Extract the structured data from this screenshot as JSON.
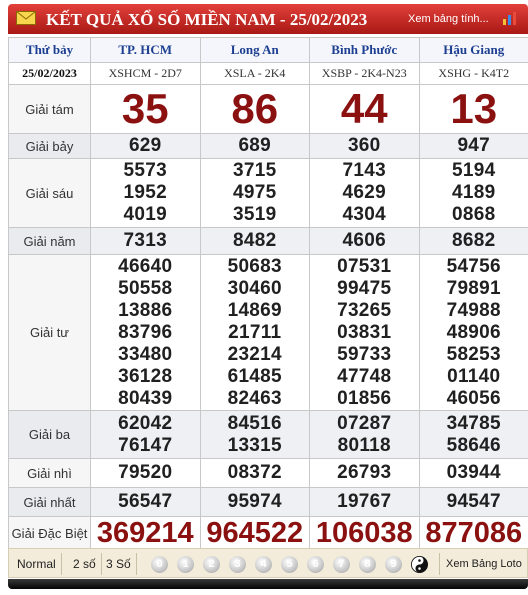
{
  "header": {
    "title": "KẾT QUẢ XỔ SỐ MIỀN NAM - 25/02/2023",
    "link": "Xem bảng tính...",
    "mail_icon": "envelope-icon",
    "chart_icon": "bar-chart-icon"
  },
  "day": "Thứ bảy",
  "date": "25/02/2023",
  "provinces": [
    {
      "name": "TP. HCM",
      "code": "XSHCM - 2D7"
    },
    {
      "name": "Long An",
      "code": "XSLA - 2K4"
    },
    {
      "name": "Bình Phước",
      "code": "XSBP - 2K4-N23"
    },
    {
      "name": "Hậu Giang",
      "code": "XSHG - K4T2"
    }
  ],
  "prizes": {
    "g8": {
      "label": "Giải tám",
      "values": [
        "35",
        "86",
        "44",
        "13"
      ]
    },
    "g7": {
      "label": "Giải bảy",
      "values": [
        "629",
        "689",
        "360",
        "947"
      ]
    },
    "g6": {
      "label": "Giải sáu",
      "values": [
        [
          "5573",
          "1952",
          "4019"
        ],
        [
          "3715",
          "4975",
          "3519"
        ],
        [
          "7143",
          "4629",
          "4304"
        ],
        [
          "5194",
          "4189",
          "0868"
        ]
      ]
    },
    "g5": {
      "label": "Giải năm",
      "values": [
        "7313",
        "8482",
        "4606",
        "8682"
      ]
    },
    "g4": {
      "label": "Giải tư",
      "values": [
        [
          "46640",
          "50558",
          "13886",
          "83796",
          "33480",
          "36128",
          "80439"
        ],
        [
          "50683",
          "30460",
          "14869",
          "21711",
          "23214",
          "61485",
          "82463"
        ],
        [
          "07531",
          "99475",
          "73265",
          "03831",
          "59733",
          "47748",
          "01856"
        ],
        [
          "54756",
          "79891",
          "74988",
          "48906",
          "58253",
          "01140",
          "46056"
        ]
      ]
    },
    "g3": {
      "label": "Giải ba",
      "values": [
        [
          "62042",
          "76147"
        ],
        [
          "84516",
          "13315"
        ],
        [
          "07287",
          "80118"
        ],
        [
          "34785",
          "58646"
        ]
      ]
    },
    "g2": {
      "label": "Giải nhì",
      "values": [
        "79520",
        "08372",
        "26793",
        "03944"
      ]
    },
    "g1": {
      "label": "Giải nhất",
      "values": [
        "56547",
        "95974",
        "19767",
        "94547"
      ]
    },
    "db": {
      "label": "Giải Đặc Biệt",
      "values": [
        "369214",
        "964522",
        "106038",
        "877086"
      ]
    }
  },
  "footer": {
    "modes": [
      "Normal",
      "2 số",
      "3 Số"
    ],
    "digits": [
      "0",
      "1",
      "2",
      "3",
      "4",
      "5",
      "6",
      "7",
      "8",
      "9"
    ],
    "yinyang_icon": "yin-yang-icon",
    "loto": "Xem Bảng Loto"
  },
  "colors": {
    "header_red": "#c0221d",
    "prize_red": "#8b1111",
    "province_blue": "#1d3f91"
  }
}
